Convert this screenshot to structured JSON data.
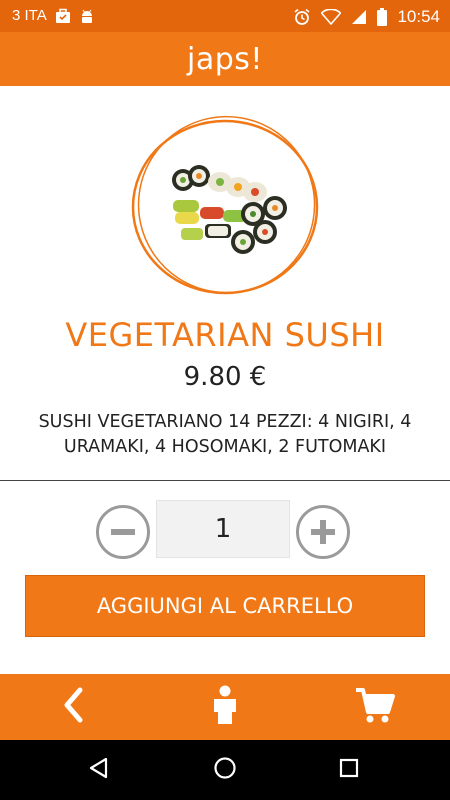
{
  "status_bar": {
    "carrier": "3 ITA",
    "time": "10:54",
    "icons": [
      "briefcase-icon",
      "android-icon",
      "alarm-icon",
      "wifi-icon",
      "signal-icon",
      "battery-icon"
    ]
  },
  "header": {
    "logo": "japs!"
  },
  "product": {
    "image": "vegetarian-sushi-plate",
    "title": "VEGETARIAN SUSHI",
    "price": "9.80 €",
    "description": "SUSHI VEGETARIANO 14 PEZZI: 4 NIGIRI, 4 URAMAKI, 4 HOSOMAKI, 2 FUTOMAKI"
  },
  "quantity": {
    "value": "1",
    "minus_icon": "minus-circle-icon",
    "plus_icon": "plus-circle-icon"
  },
  "add_to_cart": {
    "label": "AGGIUNGI AL CARRELLO"
  },
  "bottom_nav": {
    "items": [
      "back-chevron-icon",
      "user-icon",
      "cart-icon"
    ]
  },
  "system_nav": {
    "items": [
      "back-triangle-icon",
      "home-circle-icon",
      "recents-square-icon"
    ]
  },
  "colors": {
    "accent": "#f07816",
    "status_bar": "#e3660d",
    "control_gray": "#9a9a9a"
  }
}
